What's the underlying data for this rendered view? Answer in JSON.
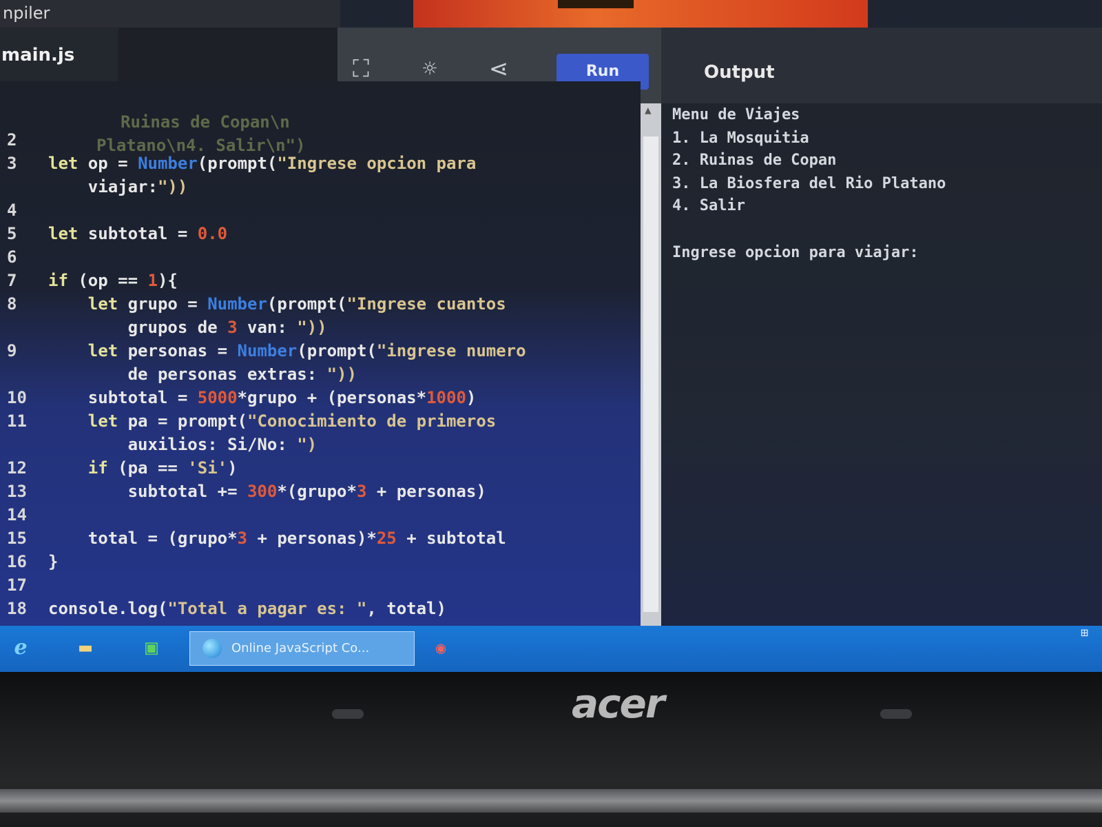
{
  "window": {
    "title_fragment": "npiler"
  },
  "tabs": {
    "active_file": "main.js"
  },
  "toolbar": {
    "fullscreen_icon": "expand-icon",
    "theme_icon": "sun-icon",
    "share_icon": "share-icon",
    "run_label": "Run"
  },
  "output": {
    "title": "Output",
    "lines": [
      "Menu de Viajes",
      "1. La Mosquitia",
      "2. Ruinas de Copan",
      "3. La Biosfera del Rio Platano",
      "4. Salir",
      "",
      "Ingrese opcion para viajar:"
    ]
  },
  "editor": {
    "partial_top": [
      "Ruinas de Copan\\n",
      "Platano\\n4. Salir\\n\")"
    ],
    "lines": [
      {
        "n": "2",
        "t": ""
      },
      {
        "n": "3",
        "t": "let op = Number(prompt(\"Ingrese opcion para"
      },
      {
        "n": "",
        "t": "    viajar:\"))"
      },
      {
        "n": "4",
        "t": ""
      },
      {
        "n": "5",
        "t": "let subtotal = 0.0"
      },
      {
        "n": "6",
        "t": ""
      },
      {
        "n": "7",
        "t": "if (op == 1){"
      },
      {
        "n": "8",
        "t": "    let grupo = Number(prompt(\"Ingrese cuantos"
      },
      {
        "n": "",
        "t": "        grupos de 3 van: \"))"
      },
      {
        "n": "9",
        "t": "    let personas = Number(prompt(\"ingrese numero"
      },
      {
        "n": "",
        "t": "        de personas extras: \"))"
      },
      {
        "n": "10",
        "t": "    subtotal = 5000*grupo + (personas*1000)"
      },
      {
        "n": "11",
        "t": "    let pa = prompt(\"Conocimiento de primeros"
      },
      {
        "n": "",
        "t": "        auxilios: Si/No: \")"
      },
      {
        "n": "12",
        "t": "    if (pa == 'Si')"
      },
      {
        "n": "13",
        "t": "        subtotal += 300*(grupo*3 + personas)"
      },
      {
        "n": "14",
        "t": ""
      },
      {
        "n": "15",
        "t": "    total = (grupo*3 + personas)*25 + subtotal"
      },
      {
        "n": "16",
        "t": "}"
      },
      {
        "n": "17",
        "t": ""
      },
      {
        "n": "18",
        "t": "console.log(\"Total a pagar es: \", total)"
      }
    ]
  },
  "taskbar": {
    "app_label": "Online JavaScript Co...",
    "icons": [
      "ie-icon",
      "folder-icon",
      "store-icon",
      "chrome-icon"
    ]
  },
  "hardware": {
    "brand": "acer"
  },
  "colors": {
    "run_button": "#3b59c8",
    "taskbar": "#1a78d6"
  }
}
